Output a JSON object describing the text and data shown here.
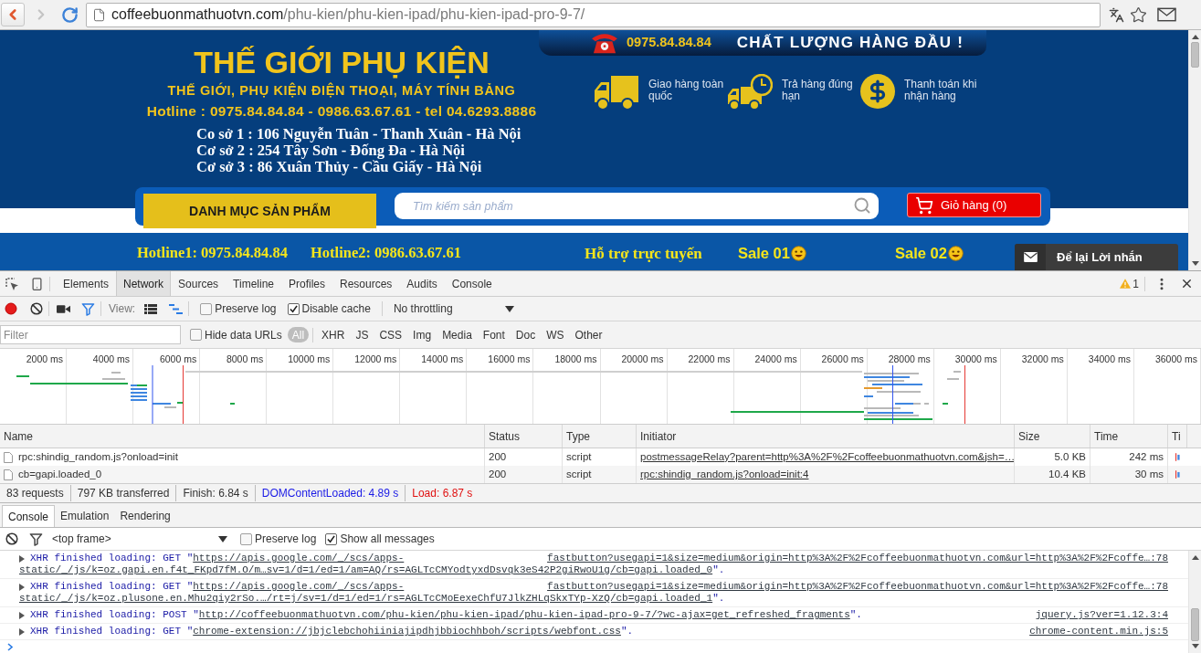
{
  "browser": {
    "url": {
      "host": "coffeebuonmathuotvn.com",
      "path": "/phu-kien/phu-kien-ipad/phu-kien-ipad-pro-9-7/"
    }
  },
  "page": {
    "top_band": {
      "phone": "0975.84.84.84",
      "slogan": "CHẤT LƯỢNG HÀNG ĐẦU !"
    },
    "header": {
      "title": "THẾ GIỚI PHỤ KIỆN",
      "subtitle": "THẾ GIỚI, PHỤ KIỆN ĐIỆN THOẠI, MÁY TÍNH BẢNG",
      "hotline": "Hotline : 0975.84.84.84 - 0986.63.67.61 - tel 04.6293.8886",
      "addresses": [
        "Co sở 1 : 106 Nguyễn Tuân - Thanh Xuân - Hà Nội",
        "Cơ sở 2 : 254 Tây Sơn - Đống Đa - Hà Nội",
        "Cơ sở 3 : 86 Xuân Thủy - Cầu Giấy - Hà Nội"
      ]
    },
    "features": [
      {
        "kind": "truck",
        "label": "Giao hàng toàn quốc"
      },
      {
        "kind": "truck-clock",
        "label": "Trả hàng đúng hạn"
      },
      {
        "kind": "dollar",
        "label": "Thanh toán khi nhận hàng"
      }
    ],
    "search_bar": {
      "category_button": "DANH MỤC SẢN PHẨM",
      "search": {
        "placeholder": "Tìm kiếm sản phẩm"
      },
      "cart_button": "Giỏ hàng (0)"
    },
    "nav": [
      {
        "kind": "hotline",
        "label": "Hotline1: 0975.84.84.84"
      },
      {
        "kind": "hotline",
        "label": "Hotline2: 0986.63.67.61"
      },
      {
        "kind": "support",
        "label": "Hỗ trợ trực tuyến"
      },
      {
        "kind": "sale",
        "label": "Sale 01"
      },
      {
        "kind": "sale",
        "label": "Sale 02"
      }
    ],
    "message_widget": {
      "label": "Để lại Lời nhắn"
    }
  },
  "devtools": {
    "tabs": [
      {
        "label": "Elements",
        "selected": false
      },
      {
        "label": "Network",
        "selected": true
      },
      {
        "label": "Sources",
        "selected": false
      },
      {
        "label": "Timeline",
        "selected": false
      },
      {
        "label": "Profiles",
        "selected": false
      },
      {
        "label": "Resources",
        "selected": false
      },
      {
        "label": "Audits",
        "selected": false
      },
      {
        "label": "Console",
        "selected": false
      }
    ],
    "warning_count": "1",
    "network": {
      "toolbar": {
        "recording": true,
        "filter_active": true,
        "view_label": "View:",
        "view_buttons": [
          {
            "kind": "large-rows",
            "selected": false
          },
          {
            "kind": "overview",
            "selected": true
          }
        ],
        "checkboxes": [
          {
            "label": "Preserve log",
            "checked": false
          },
          {
            "label": "Disable cache",
            "checked": true
          }
        ],
        "throttling": "No throttling"
      },
      "filter_bar": {
        "placeholder": "Filter",
        "hide_data_urls": {
          "label": "Hide data URLs",
          "checked": false
        },
        "types": [
          {
            "label": "All",
            "selected": true
          },
          {
            "label": "XHR",
            "selected": false
          },
          {
            "label": "JS",
            "selected": false
          },
          {
            "label": "CSS",
            "selected": false
          },
          {
            "label": "Img",
            "selected": false
          },
          {
            "label": "Media",
            "selected": false
          },
          {
            "label": "Font",
            "selected": false
          },
          {
            "label": "Doc",
            "selected": false
          },
          {
            "label": "WS",
            "selected": false
          },
          {
            "label": "Other",
            "selected": false
          }
        ]
      },
      "overview_ticks": [
        "2000 ms",
        "4000 ms",
        "6000 ms",
        "8000 ms",
        "10000 ms",
        "12000 ms",
        "14000 ms",
        "16000 ms",
        "18000 ms",
        "20000 ms",
        "22000 ms",
        "24000 ms",
        "26000 ms",
        "28000 ms",
        "30000 ms",
        "32000 ms",
        "34000 ms",
        "36000 ms"
      ],
      "table": {
        "columns": [
          "Name",
          "Status",
          "Type",
          "Initiator",
          "Size",
          "Time",
          "Ti"
        ],
        "rows": [
          {
            "name": "rpc:shindig_random.js?onload=init",
            "status": "200",
            "type": "script",
            "initiator": "postmessageRelay?parent=http%3A%2F%2Fcoffeebuonmathuotvn.com&jsh=…",
            "size": "5.0 KB",
            "time": "242 ms"
          },
          {
            "name": "cb=gapi.loaded_0",
            "status": "200",
            "type": "script",
            "initiator": "rpc:shindig_random.js?onload=init:4",
            "size": "10.4 KB",
            "time": "30 ms"
          }
        ]
      },
      "summary": [
        {
          "kind": "plain",
          "text": "83 requests"
        },
        {
          "kind": "plain",
          "text": "797 KB transferred"
        },
        {
          "kind": "plain",
          "text": "Finish: 6.84 s"
        },
        {
          "kind": "dom-content-loaded",
          "text": "DOMContentLoaded: 4.89 s"
        },
        {
          "kind": "load",
          "text": "Load: 6.87 s"
        }
      ]
    },
    "drawer": {
      "tabs": [
        {
          "label": "Console",
          "selected": true
        },
        {
          "label": "Emulation",
          "selected": false
        },
        {
          "label": "Rendering",
          "selected": false
        }
      ],
      "toolbar": {
        "context": "<top frame>",
        "checkboxes": [
          {
            "label": "Preserve log",
            "checked": false
          },
          {
            "label": "Show all messages",
            "checked": true
          }
        ]
      },
      "messages": [
        {
          "text": "XHR finished loading: GET \"",
          "url_lines": [
            "https://apis.google.com/_/scs/apps-",
            "static/_/js/k=oz.gapi.en.f4t_FKpd7fM.O/m…sv=1/d=1/ed=1/am=AQ/rs=AGLTcCMYodtyxdDsvqk3eS42P2giRwoU1g/cb=gapi.loaded_0"
          ],
          "suffix": "\".",
          "source": "fastbutton?usegapi=1&size=medium&origin=http%3A%2F%2Fcoffeebuonmathuotvn.com&url=http%3A%2F%2Fcoffe…:78"
        },
        {
          "text": "XHR finished loading: GET \"",
          "url_lines": [
            "https://apis.google.com/_/scs/apps-",
            "static/_/js/k=oz.plusone.en.Mhu2qiy2rSo.…/rt=j/sv=1/d=1/ed=1/rs=AGLTcCMoEexeChfU7JlkZHLqSkxTYp-XzQ/cb=gapi.loaded_1"
          ],
          "suffix": "\".",
          "source": "fastbutton?usegapi=1&size=medium&origin=http%3A%2F%2Fcoffeebuonmathuotvn.com&url=http%3A%2F%2Fcoffe…:78"
        },
        {
          "text": "XHR finished loading: POST \"",
          "url_lines": [
            "http://coffeebuonmathuotvn.com/phu-kien/phu-kien-ipad/phu-kien-ipad-pro-9-7/?wc-ajax=get_refreshed_fragments"
          ],
          "suffix": "\".",
          "source": "jquery.js?ver=1.12.3:4"
        },
        {
          "text": "XHR finished loading: GET \"",
          "url_lines": [
            "chrome-extension://jbjclebchohiiniajipdhjbbiochhboh/scripts/webfont.css"
          ],
          "suffix": "\".",
          "source": "chrome-content.min.js:5"
        }
      ]
    }
  }
}
